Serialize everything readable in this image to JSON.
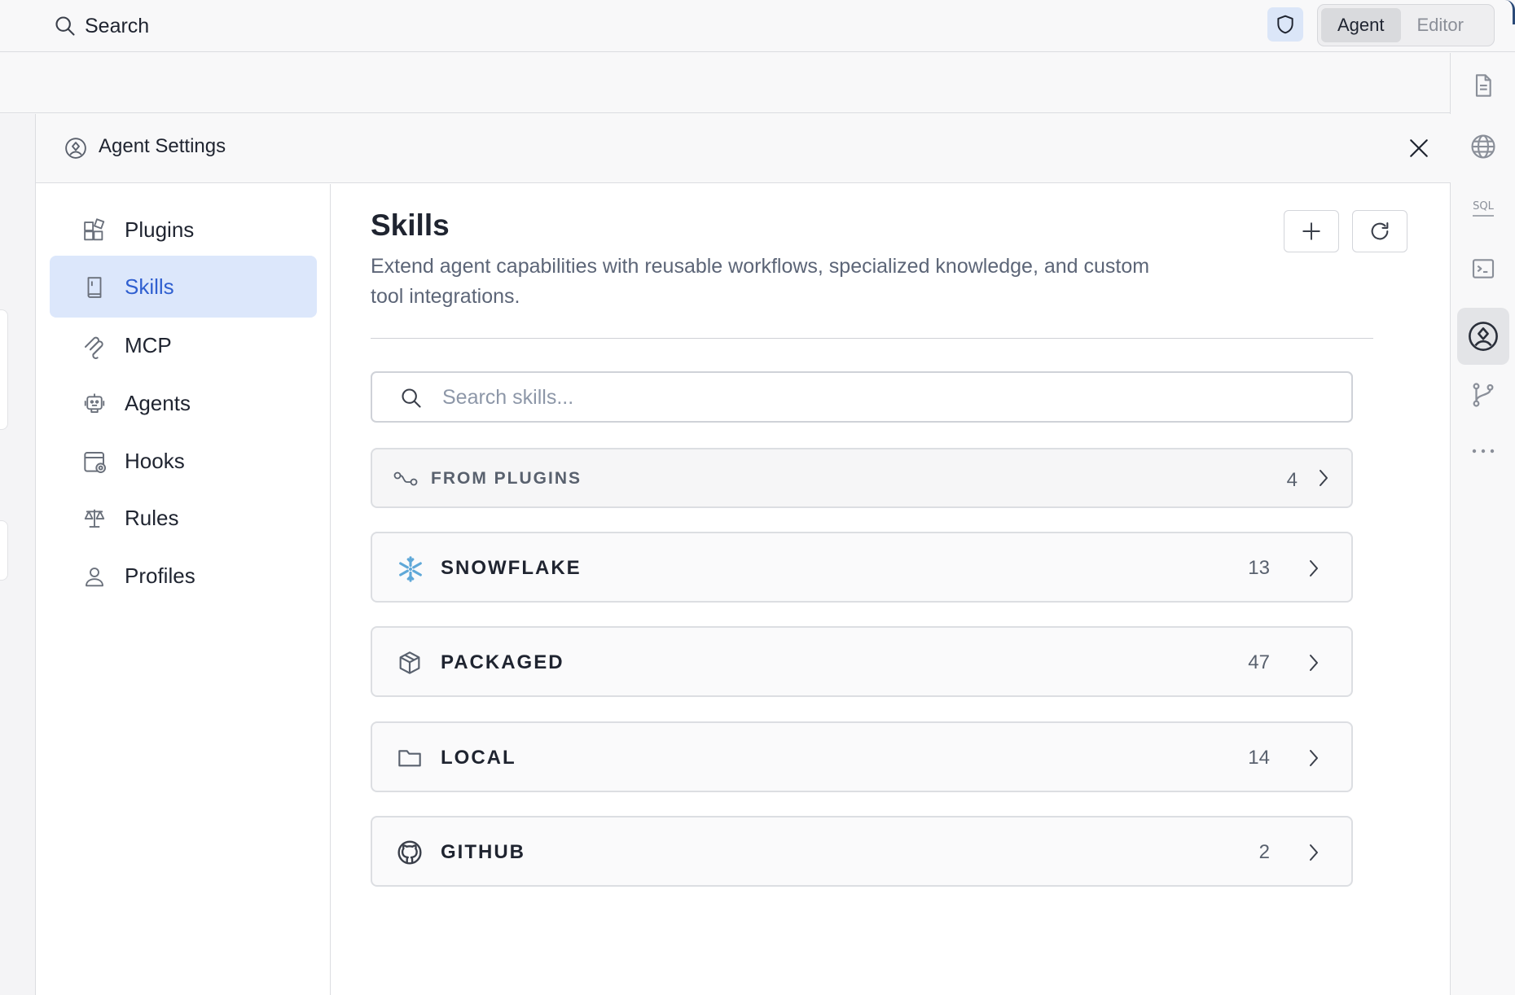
{
  "topbar": {
    "search_label": "Search",
    "mode_tabs": [
      {
        "label": "Agent",
        "active": true
      },
      {
        "label": "Editor",
        "active": false
      }
    ]
  },
  "rail": {
    "items": [
      "file-icon",
      "globe-icon",
      "sql-icon",
      "terminal-icon",
      "agent-settings-icon",
      "git-branch-icon",
      "more-icon"
    ],
    "active_item": "agent-settings-icon"
  },
  "panel": {
    "title": "Agent Settings"
  },
  "nav": {
    "items": [
      {
        "label": "Plugins",
        "icon": "plugins-icon",
        "active": false
      },
      {
        "label": "Skills",
        "icon": "book-icon",
        "active": true
      },
      {
        "label": "MCP",
        "icon": "mcp-icon",
        "active": false
      },
      {
        "label": "Agents",
        "icon": "robot-icon",
        "active": false
      },
      {
        "label": "Hooks",
        "icon": "hooks-icon",
        "active": false
      },
      {
        "label": "Rules",
        "icon": "scale-icon",
        "active": false
      },
      {
        "label": "Profiles",
        "icon": "user-icon",
        "active": false
      }
    ]
  },
  "skills": {
    "title": "Skills",
    "description": "Extend agent capabilities with reusable workflows, specialized knowledge, and custom tool integrations.",
    "search_placeholder": "Search skills...",
    "search_value": "",
    "groups": [
      {
        "label": "FROM PLUGINS",
        "count": "4",
        "icon": "plugin-route-icon"
      },
      {
        "label": "SNOWFLAKE",
        "count": "13",
        "icon": "snowflake-icon"
      },
      {
        "label": "PACKAGED",
        "count": "47",
        "icon": "package-icon"
      },
      {
        "label": "LOCAL",
        "count": "14",
        "icon": "folder-icon"
      },
      {
        "label": "GITHUB",
        "count": "2",
        "icon": "github-icon"
      }
    ]
  },
  "colors": {
    "accent": "#2f5fd0",
    "active_nav_bg": "#dce7fb",
    "shield_bg": "#dbe6f8",
    "snowflake": "#5fa8d8"
  }
}
